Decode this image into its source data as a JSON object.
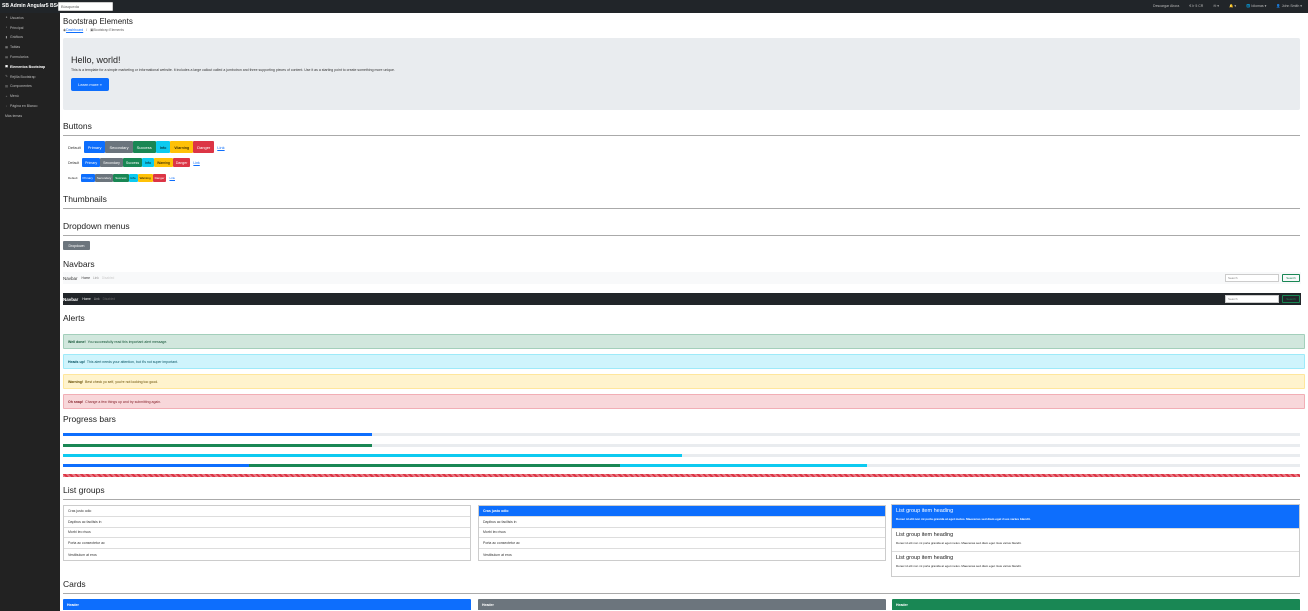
{
  "topbar": {
    "brand": "SB Admin Angular5 BS4",
    "search_placeholder": "Búsqueda",
    "nav": [
      "Descargar Ahora",
      "€ Ir 5 CR",
      "✉ ▾",
      "🔔 ▾",
      "🌐 Idiomas ▾",
      "👤 John Smith ▾"
    ]
  },
  "sidebar": {
    "items": [
      {
        "icon": "user-icon",
        "label": "Usuarios"
      },
      {
        "icon": "dashboard-icon",
        "label": "Principal"
      },
      {
        "icon": "chart-icon",
        "label": "Gráficos"
      },
      {
        "icon": "table-icon",
        "label": "Tablas"
      },
      {
        "icon": "form-icon",
        "label": "Formularios"
      },
      {
        "icon": "desktop-icon",
        "label": "Elementos Bootstrap",
        "active": true
      },
      {
        "icon": "wrench-icon",
        "label": "Rejilla Bootstrap"
      },
      {
        "icon": "component-icon",
        "label": "Componentes"
      },
      {
        "icon": "plus-icon",
        "label": "Menú"
      },
      {
        "icon": "file-icon",
        "label": "Página en Blanco"
      },
      {
        "icon": "",
        "label": "Más temas"
      }
    ]
  },
  "page": {
    "title": "Bootstrap Elements",
    "breadcrumb_dashboard": "Dashboard",
    "breadcrumb_sep": "/",
    "breadcrumb_current": "Bootstrap Elements"
  },
  "jumbotron": {
    "heading": "Hello, world!",
    "text": "This is a template for a simple marketing or informational website. It includes a large callout called a jumbotron and three supporting pieces of content. Use it as a starting point to create something more unique.",
    "button": "Learn more »"
  },
  "sections": {
    "buttons": "Buttons",
    "thumbnails": "Thumbnails",
    "dropdowns": "Dropdown menus",
    "navbars": "Navbars",
    "alerts": "Alerts",
    "progress": "Progress bars",
    "list_groups": "List groups",
    "cards": "Cards"
  },
  "buttons": {
    "default_label": "Default",
    "labels": [
      "Primary",
      "Secondary",
      "Success",
      "Info",
      "Warning",
      "Danger"
    ],
    "link": "Link"
  },
  "dropdown": {
    "button": "Dropdown"
  },
  "navbars": {
    "brand": "Navbar",
    "home": "Home",
    "link": "Link",
    "disabled": "Disabled",
    "search_placeholder": "Search",
    "search_button": "Search"
  },
  "alerts": [
    {
      "strong": "Well done!",
      "text": "You successfully read this important alert message."
    },
    {
      "strong": "Heads up!",
      "text": "This alert needs your attention, but it's not super important."
    },
    {
      "strong": "Warning!",
      "text": "Best check yo self, you're not looking too good."
    },
    {
      "strong": "Oh snap!",
      "text": "Change a few things up and try submitting again."
    }
  ],
  "progress_bars": [
    {
      "segments": [
        {
          "value": 25,
          "color": "#0d6efd"
        }
      ]
    },
    {
      "segments": [
        {
          "value": 25,
          "color": "#198754"
        }
      ]
    },
    {
      "segments": [
        {
          "value": 50,
          "color": "#0dcaf0"
        }
      ]
    },
    {
      "segments": [
        {
          "value": 15,
          "color": "#0d6efd"
        },
        {
          "value": 30,
          "color": "#198754"
        },
        {
          "value": 20,
          "color": "#0dcaf0"
        }
      ]
    },
    {
      "segments": [
        {
          "value": 100,
          "color": "#dc3545",
          "striped": true
        }
      ]
    }
  ],
  "list_groups": {
    "items": [
      "Cras justo odio",
      "Dapibus ac facilisis in",
      "Morbi leo risus",
      "Porta ac consectetur ac",
      "Vestibulum at eros"
    ],
    "heading": "List group item heading",
    "text": "Donec id elit non mi porta gravida at eget metus. Maecenas sed diam eget risus varius blandit."
  },
  "cards": [
    "Header",
    "Header",
    "Header"
  ],
  "colors": {
    "primary": "#0d6efd",
    "secondary": "#6c757d",
    "success": "#198754",
    "info": "#0dcaf0",
    "warning": "#ffc107",
    "danger": "#dc3545"
  }
}
